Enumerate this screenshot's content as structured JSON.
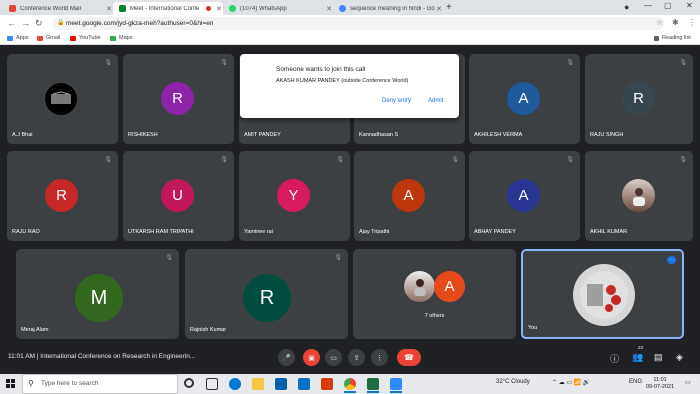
{
  "browser": {
    "tabs": [
      {
        "label": "Conference World Mail",
        "icon": "gmail-icon",
        "active": false
      },
      {
        "label": "Meet - International Confe",
        "icon": "meet-icon",
        "active": true,
        "recording": true
      },
      {
        "label": "(1074) WhatsApp",
        "icon": "whatsapp-icon",
        "active": false
      },
      {
        "label": "sequence meaning in hindi - Goo",
        "icon": "google-icon",
        "active": false
      }
    ],
    "url": "meet.google.com/jyd-gkza-meh?authuser=0&hl=en",
    "bookmarks": [
      {
        "label": "Apps",
        "icon": "apps-grid-icon"
      },
      {
        "label": "Gmail",
        "icon": "gmail-icon"
      },
      {
        "label": "YouTube",
        "icon": "youtube-icon"
      },
      {
        "label": "Maps",
        "icon": "maps-icon"
      }
    ],
    "reading_list": "Reading list"
  },
  "participants_row1": [
    {
      "name": "A.J Bhai",
      "initial": "",
      "color": "#000000",
      "type": "logo"
    },
    {
      "name": "RISHIKESH",
      "initial": "R",
      "color": "#8e24aa"
    },
    {
      "name": "AMIT PANDEY",
      "initial": "",
      "color": "#3c4043",
      "type": "hidden"
    },
    {
      "name": "Kannadhasan S",
      "initial": "",
      "color": "#3c4043",
      "type": "hidden"
    },
    {
      "name": "AKHILESH VERMA",
      "initial": "A",
      "color": "#1e5a9c"
    },
    {
      "name": "RAJU SINGH",
      "initial": "R",
      "color": "#37474f"
    }
  ],
  "participants_row2": [
    {
      "name": "RAJU RAO",
      "initial": "R",
      "color": "#c62828"
    },
    {
      "name": "UTKARSH RAM TRIPATHI",
      "initial": "U",
      "color": "#c2185b"
    },
    {
      "name": "Yaminee rai",
      "initial": "Y",
      "color": "#d81b60"
    },
    {
      "name": "Ajay Tripathi",
      "initial": "A",
      "color": "#bf360c"
    },
    {
      "name": "ABHAY PANDEY",
      "initial": "A",
      "color": "#283593"
    },
    {
      "name": "AKHIL KUMAR",
      "initial": "",
      "color": "#6d4c41",
      "type": "photo"
    }
  ],
  "participants_row3": [
    {
      "name": "Meraj Alam",
      "initial": "M",
      "color": "#33691e"
    },
    {
      "name": "Rajnish Kumar",
      "initial": "R",
      "color": "#004d40"
    },
    {
      "name": "7 others",
      "initial": "A",
      "color": "#e64a19",
      "type": "others"
    },
    {
      "name": "You",
      "initial": "",
      "color": "#cfcfcf",
      "type": "you"
    }
  ],
  "join_dialog": {
    "title": "Someone wants to join this call",
    "requester": "AKASH KUMAR PANDEY (outside Conference World)",
    "deny_label": "Deny entry",
    "admit_label": "Admit"
  },
  "meeting_bar": {
    "time_title": "11:01 AM  |  International Conference on Research in Engineerin...",
    "participant_count": "23"
  },
  "taskbar": {
    "search_placeholder": "Type here to search",
    "weather": "32°C  Cloudy",
    "language": "ENG",
    "time": "11:01",
    "date": "09-07-2021"
  }
}
